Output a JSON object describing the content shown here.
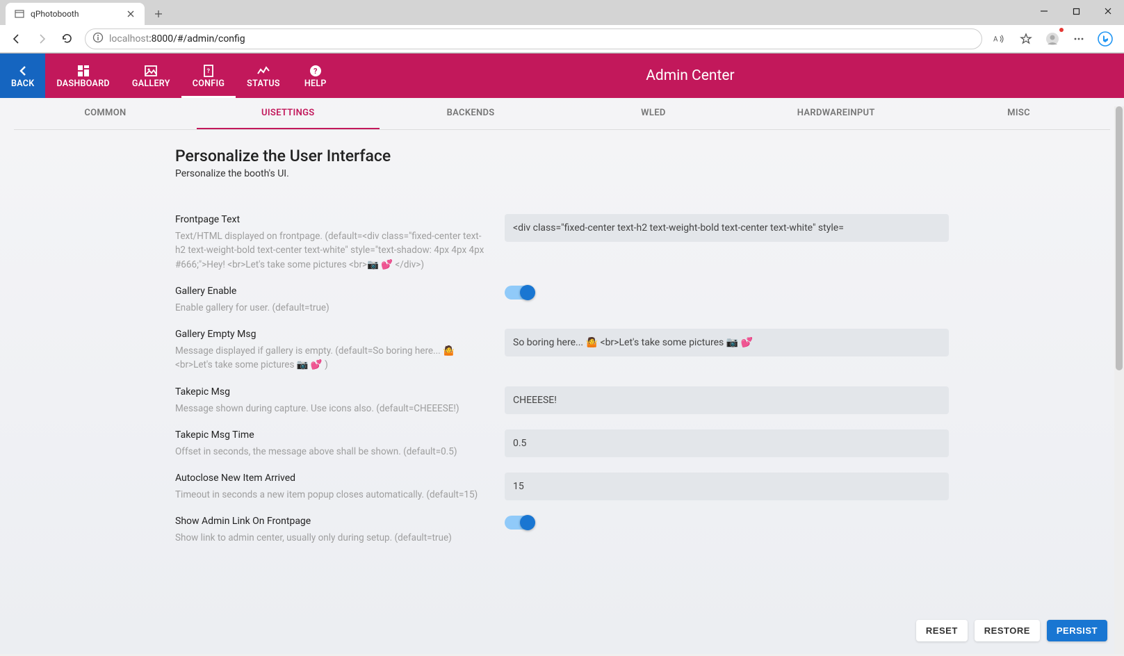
{
  "browser": {
    "tab_title": "qPhotobooth",
    "url_host_dim": "localhost",
    "url_rest": ":8000/#/admin/config"
  },
  "header": {
    "title": "Admin Center",
    "nav": {
      "back": "BACK",
      "dashboard": "DASHBOARD",
      "gallery": "GALLERY",
      "config": "CONFIG",
      "status": "STATUS",
      "help": "HELP"
    }
  },
  "tabs": {
    "common": "COMMON",
    "uisettings": "UISETTINGS",
    "backends": "BACKENDS",
    "wled": "WLED",
    "hardwareinput": "HARDWAREINPUT",
    "misc": "MISC"
  },
  "section": {
    "title": "Personalize the User Interface",
    "sub": "Personalize the booth's UI."
  },
  "fields": {
    "frontpage_text": {
      "label": "Frontpage Text",
      "help": "Text/HTML displayed on frontpage. (default=<div class=\"fixed-center text-h2 text-weight-bold text-center text-white\" style=\"text-shadow: 4px 4px 4px #666;\">Hey! <br>Let's take some pictures <br>📷 💕 </div>)",
      "value": "<div class=\"fixed-center text-h2 text-weight-bold text-center text-white\" style="
    },
    "gallery_enable": {
      "label": "Gallery Enable",
      "help": "Enable gallery for user. (default=true)",
      "value": true
    },
    "gallery_empty_msg": {
      "label": "Gallery Empty Msg",
      "help": "Message displayed if gallery is empty. (default=So boring here... 🤷 <br>Let's take some pictures 📷 💕 )",
      "value": "So boring here... 🤷 <br>Let's take some pictures 📷 💕"
    },
    "takepic_msg": {
      "label": "Takepic Msg",
      "help": "Message shown during capture. Use icons also. (default=CHEEESE!)",
      "value": "CHEEESE!"
    },
    "takepic_msg_time": {
      "label": "Takepic Msg Time",
      "help": "Offset in seconds, the message above shall be shown. (default=0.5)",
      "value": "0.5"
    },
    "autoclose": {
      "label": "Autoclose New Item Arrived",
      "help": "Timeout in seconds a new item popup closes automatically. (default=15)",
      "value": "15"
    },
    "show_admin_link": {
      "label": "Show Admin Link On Frontpage",
      "help": "Show link to admin center, usually only during setup. (default=true)",
      "value": true
    }
  },
  "footer": {
    "reset": "RESET",
    "restore": "RESTORE",
    "persist": "PERSIST"
  }
}
